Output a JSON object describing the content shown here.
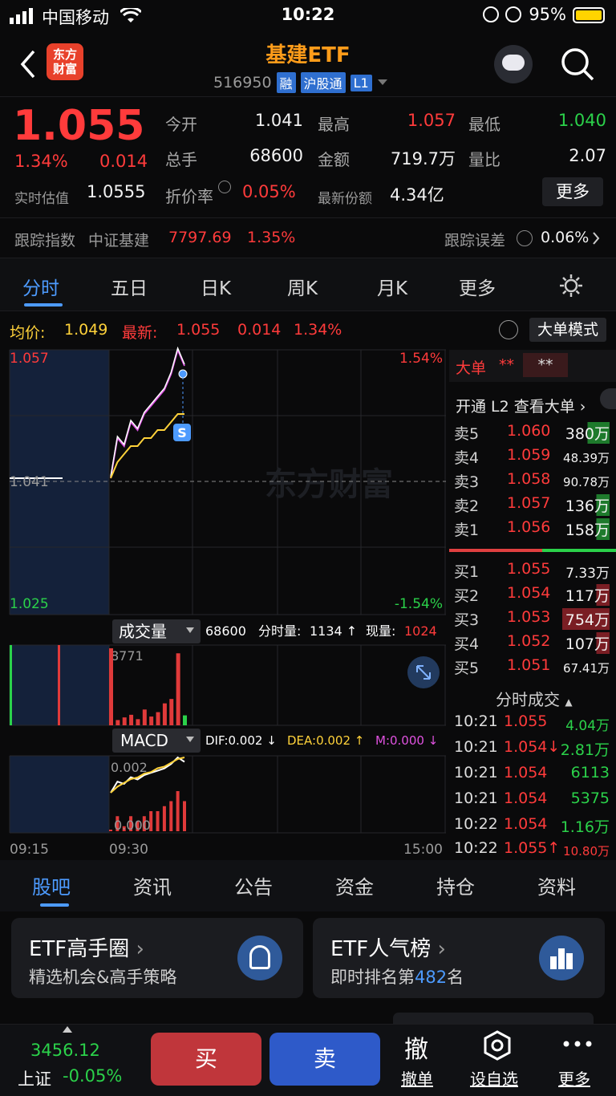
{
  "status_bar": {
    "carrier": "中国移动",
    "time": "10:22",
    "battery": "95%"
  },
  "header": {
    "logo_line1": "东方",
    "logo_line2": "财富",
    "title": "基建ETF",
    "code": "516950",
    "tags": [
      "融",
      "沪股通",
      "L1"
    ]
  },
  "quote": {
    "price": "1.055",
    "change_pct": "1.34%",
    "change": "0.014",
    "open_label": "今开",
    "open": "1.041",
    "high_label": "最高",
    "high": "1.057",
    "low_label": "最低",
    "low": "1.040",
    "volume_label": "总手",
    "volume": "68600",
    "amount_label": "金额",
    "amount": "719.7万",
    "vol_ratio_label": "量比",
    "vol_ratio": "2.07",
    "iopv_label": "实时估值",
    "iopv": "1.0555",
    "discount_label": "折价率",
    "discount": "0.05%",
    "shares_label": "最新份额",
    "shares": "4.34亿",
    "more": "更多",
    "track_label": "跟踪指数",
    "track_index": "中证基建",
    "track_value": "7797.69",
    "track_pct": "1.35%",
    "track_err_label": "跟踪误差",
    "track_err": "0.06%"
  },
  "period_tabs": [
    "分时",
    "五日",
    "日K",
    "周K",
    "月K",
    "更多"
  ],
  "chart_info": {
    "avg_label": "均价:",
    "avg": "1.049",
    "latest_label": "最新:",
    "latest": "1.055",
    "latest_chg": "0.014",
    "latest_pct": "1.34%",
    "big_order_mode": "大单模式"
  },
  "chart_axes": {
    "top_price": "1.057",
    "mid_price": "1.041",
    "bottom_price": "1.025",
    "top_pct": "1.54%",
    "bottom_pct": "-1.54%",
    "watermark": "东方财富",
    "s_marker": "S",
    "times": [
      "09:15",
      "09:30",
      "15:00"
    ]
  },
  "volume_panel": {
    "label": "成交量",
    "total": "68600",
    "minute_label": "分时量:",
    "minute": "1134 ↑",
    "now_label": "现量:",
    "now": "1024",
    "max": "8771"
  },
  "macd_panel": {
    "label": "MACD",
    "dif": "DIF:0.002 ↓",
    "dea": "DEA:0.002 ↑",
    "m": "M:0.000 ↓",
    "top": "0.002",
    "bottom": "0.000"
  },
  "chart_data": {
    "type": "line",
    "x": [
      "09:30",
      "09:35",
      "09:40",
      "09:45",
      "09:50",
      "09:55",
      "10:00",
      "10:05",
      "10:10",
      "10:15",
      "10:20",
      "10:22"
    ],
    "series": [
      {
        "name": "最新",
        "values": [
          1.041,
          1.046,
          1.045,
          1.048,
          1.047,
          1.049,
          1.05,
          1.051,
          1.052,
          1.054,
          1.057,
          1.055
        ]
      },
      {
        "name": "均价",
        "values": [
          1.041,
          1.043,
          1.044,
          1.045,
          1.045,
          1.046,
          1.046,
          1.047,
          1.047,
          1.048,
          1.049,
          1.049
        ]
      }
    ],
    "volume": [
      8771,
      600,
      900,
      1200,
      700,
      1800,
      1000,
      1500,
      2500,
      3000,
      8200,
      1134
    ],
    "ylim": [
      1.025,
      1.057
    ],
    "prev_close": 1.041
  },
  "order_book": {
    "header_label": "大单",
    "header_a": "**",
    "header_b": "**",
    "l2_link": "开通 L2 查看大单",
    "asks": [
      {
        "label": "卖5",
        "price": "1.060",
        "vol": "380万"
      },
      {
        "label": "卖4",
        "price": "1.059",
        "vol": "48.39万"
      },
      {
        "label": "卖3",
        "price": "1.058",
        "vol": "90.78万"
      },
      {
        "label": "卖2",
        "price": "1.057",
        "vol": "136万"
      },
      {
        "label": "卖1",
        "price": "1.056",
        "vol": "158万"
      }
    ],
    "bids": [
      {
        "label": "买1",
        "price": "1.055",
        "vol": "7.33万"
      },
      {
        "label": "买2",
        "price": "1.054",
        "vol": "117万"
      },
      {
        "label": "买3",
        "price": "1.053",
        "vol": "754万"
      },
      {
        "label": "买4",
        "price": "1.052",
        "vol": "107万"
      },
      {
        "label": "买5",
        "price": "1.051",
        "vol": "67.41万"
      }
    ],
    "ticks_label": "分时成交",
    "ticks": [
      {
        "time": "10:21",
        "price": "1.055",
        "vol": "4.04万"
      },
      {
        "time": "10:21",
        "price": "1.054↓",
        "vol": "2.81万"
      },
      {
        "time": "10:21",
        "price": "1.054",
        "vol": "6113"
      },
      {
        "time": "10:21",
        "price": "1.054",
        "vol": "5375"
      },
      {
        "time": "10:22",
        "price": "1.054",
        "vol": "1.16万"
      },
      {
        "time": "10:22",
        "price": "1.055↑",
        "vol": "10.80万"
      }
    ]
  },
  "bottom_tabs": [
    "股吧",
    "资讯",
    "公告",
    "资金",
    "持仓",
    "资料"
  ],
  "cards": [
    {
      "title": "ETF高手圈",
      "sub": "精选机会&高手策略"
    },
    {
      "title": "ETF人气榜",
      "sub_prefix": "即时排名第",
      "sub_num": "482",
      "sub_suffix": "名"
    }
  ],
  "action_bar": {
    "index_value": "3456.12",
    "index_name": "上证",
    "index_pct": "-0.05%",
    "buy": "买",
    "sell": "卖",
    "cancel": "撤单",
    "cancel_glyph": "撤",
    "watch": "设自选",
    "more": "更多"
  }
}
